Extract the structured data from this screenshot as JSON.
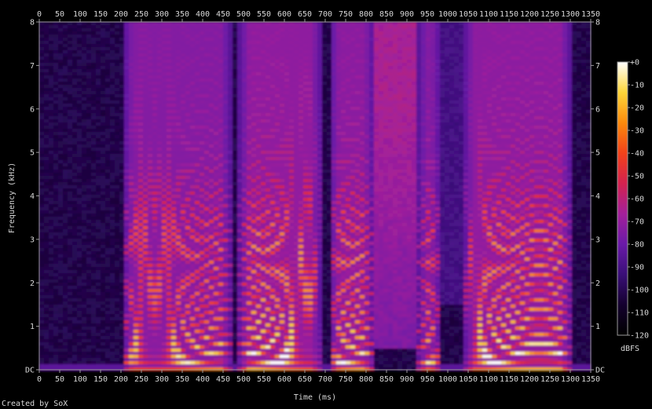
{
  "chart_data": {
    "type": "heatmap",
    "title": "",
    "xlabel": "Time (ms)",
    "ylabel": "Frequency (kHz)",
    "xlim": [
      0,
      1350
    ],
    "ylim": [
      0,
      8
    ],
    "x_ticks": [
      "0",
      "50",
      "100",
      "150",
      "200",
      "250",
      "300",
      "350",
      "400",
      "450",
      "500",
      "550",
      "600",
      "650",
      "700",
      "750",
      "800",
      "850",
      "900",
      "950",
      "1000",
      "1050",
      "1100",
      "1150",
      "1200",
      "1250",
      "1300",
      "1350"
    ],
    "y_ticks": [
      "DC",
      "1",
      "2",
      "3",
      "4",
      "5",
      "6",
      "7",
      "8"
    ],
    "colorbar": {
      "label": "dBFS",
      "ticks": [
        "+0",
        "-10",
        "-20",
        "-30",
        "-40",
        "-50",
        "-60",
        "-70",
        "-80",
        "-90",
        "-100",
        "-110",
        "-120"
      ],
      "range": [
        -120,
        0
      ],
      "colors": [
        "#000000",
        "#14002e",
        "#3a0f78",
        "#6a1aa8",
        "#a3209a",
        "#d4224f",
        "#f2421a",
        "#fb8a0d",
        "#fdd63a",
        "#ffffff"
      ]
    },
    "grid": false
  },
  "footer": {
    "credit": "Created by SoX"
  }
}
